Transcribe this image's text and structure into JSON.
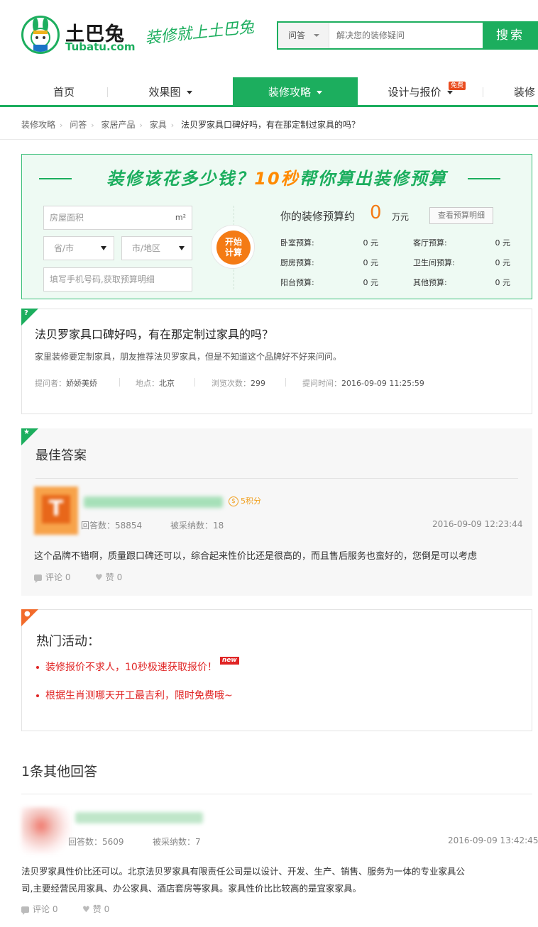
{
  "header": {
    "logo_name": "土巴兔",
    "logo_domain": "Tubatu.com",
    "slogan": "装修就上土巴兔",
    "search": {
      "category": "问答",
      "placeholder": "解决您的装修疑问",
      "button": "搜索"
    }
  },
  "nav": {
    "items": [
      {
        "label": "首页"
      },
      {
        "label": "效果图"
      },
      {
        "label": "装修攻略"
      },
      {
        "label": "设计与报价"
      },
      {
        "label": "装修"
      }
    ],
    "free_badge": "免费",
    "accent": "#1cae5e"
  },
  "breadcrumb": {
    "items": [
      "装修攻略",
      "问答",
      "家居产品",
      "家具"
    ],
    "current": "法贝罗家具口碑好吗，有在那定制过家具的吗？"
  },
  "calculator": {
    "title_a": "装修该花多少钱？",
    "title_b": "10秒",
    "title_c": "帮你算出装修预算",
    "area_placeholder": "房屋面积",
    "area_unit": "m²",
    "province": "省/市",
    "city": "市/地区",
    "phone_placeholder": "填写手机号码,获取预算明细",
    "start_l1": "开始",
    "start_l2": "计算",
    "budget_label": "你的装修预算约",
    "budget_value": "0",
    "budget_unit": "万元",
    "detail_button": "查看预算明细",
    "rooms": [
      {
        "label": "卧室预算:",
        "value": "0 元"
      },
      {
        "label": "客厅预算:",
        "value": "0 元"
      },
      {
        "label": "厨房预算:",
        "value": "0 元"
      },
      {
        "label": "卫生间预算:",
        "value": "0 元"
      },
      {
        "label": "阳台预算:",
        "value": "0 元"
      },
      {
        "label": "其他预算:",
        "value": "0 元"
      }
    ]
  },
  "question": {
    "title": "法贝罗家具口碑好吗，有在那定制过家具的吗？",
    "description": "家里装修要定制家具，朋友推荐法贝罗家具，但是不知道这个品牌好不好来问问。",
    "asker_label": "提问者：",
    "asker": "娇娇美娇",
    "location_label": "地点：",
    "location": "北京",
    "views_label": "浏览次数：",
    "views": "299",
    "time_label": "提问时间：",
    "time": "2016-09-09 11:25:59"
  },
  "best_answer": {
    "section_title": "最佳答案",
    "avatar_letter": "T",
    "points": "5积分",
    "answers_label": "回答数：",
    "answers": "58854",
    "adopted_label": "被采纳数：",
    "adopted": "18",
    "time": "2016-09-09 12:23:44",
    "content": "这个品牌不错啊，质量跟口碑还可以，综合起来性价比还是很高的，而且售后服务也蛮好的，您倒是可以考虑",
    "comments": "评论 0",
    "likes": "赞 0"
  },
  "hot": {
    "title": "热门活动：",
    "items": [
      {
        "text": "装修报价不求人，10秒极速获取报价！",
        "badge": "new"
      },
      {
        "text": "根据生肖测哪天开工最吉利，限时免费哦~"
      }
    ]
  },
  "other_answers": {
    "title": "1条其他回答",
    "answers_label": "回答数：",
    "answers": "5609",
    "adopted_label": "被采纳数：",
    "adopted": "7",
    "time": "2016-09-09 13:42:45",
    "content_l1": "法贝罗家具性价比还可以。北京法贝罗家具有限责任公司是以设计、开发、生产、销售、服务为一体的专业家具公",
    "content_l2": "司,主要经营民用家具、办公家具、酒店套房等家具。家具性价比比较高的是宜家家具。",
    "comments": "评论 0",
    "likes": "赞 0"
  }
}
